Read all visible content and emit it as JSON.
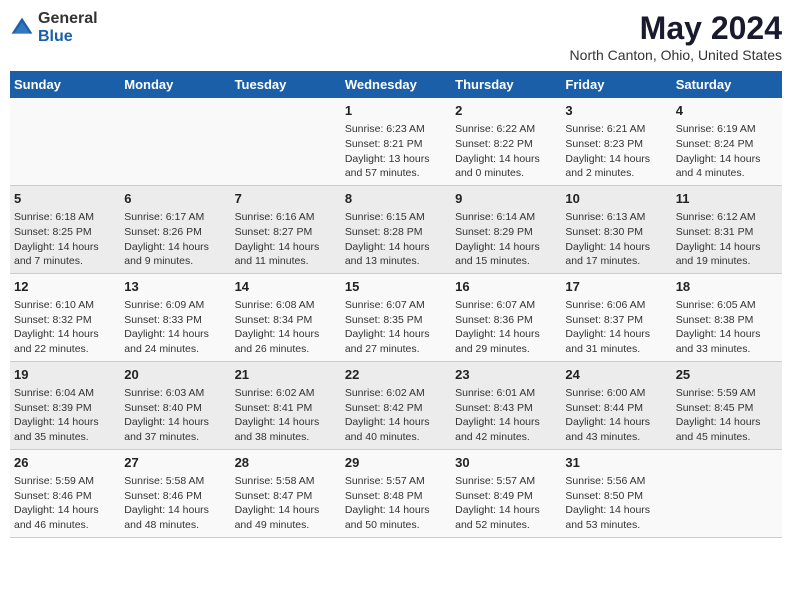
{
  "header": {
    "logo_general": "General",
    "logo_blue": "Blue",
    "title": "May 2024",
    "subtitle": "North Canton, Ohio, United States"
  },
  "columns": [
    "Sunday",
    "Monday",
    "Tuesday",
    "Wednesday",
    "Thursday",
    "Friday",
    "Saturday"
  ],
  "weeks": [
    [
      {
        "day": "",
        "info": ""
      },
      {
        "day": "",
        "info": ""
      },
      {
        "day": "",
        "info": ""
      },
      {
        "day": "1",
        "info": "Sunrise: 6:23 AM\nSunset: 8:21 PM\nDaylight: 13 hours and 57 minutes."
      },
      {
        "day": "2",
        "info": "Sunrise: 6:22 AM\nSunset: 8:22 PM\nDaylight: 14 hours and 0 minutes."
      },
      {
        "day": "3",
        "info": "Sunrise: 6:21 AM\nSunset: 8:23 PM\nDaylight: 14 hours and 2 minutes."
      },
      {
        "day": "4",
        "info": "Sunrise: 6:19 AM\nSunset: 8:24 PM\nDaylight: 14 hours and 4 minutes."
      }
    ],
    [
      {
        "day": "5",
        "info": "Sunrise: 6:18 AM\nSunset: 8:25 PM\nDaylight: 14 hours and 7 minutes."
      },
      {
        "day": "6",
        "info": "Sunrise: 6:17 AM\nSunset: 8:26 PM\nDaylight: 14 hours and 9 minutes."
      },
      {
        "day": "7",
        "info": "Sunrise: 6:16 AM\nSunset: 8:27 PM\nDaylight: 14 hours and 11 minutes."
      },
      {
        "day": "8",
        "info": "Sunrise: 6:15 AM\nSunset: 8:28 PM\nDaylight: 14 hours and 13 minutes."
      },
      {
        "day": "9",
        "info": "Sunrise: 6:14 AM\nSunset: 8:29 PM\nDaylight: 14 hours and 15 minutes."
      },
      {
        "day": "10",
        "info": "Sunrise: 6:13 AM\nSunset: 8:30 PM\nDaylight: 14 hours and 17 minutes."
      },
      {
        "day": "11",
        "info": "Sunrise: 6:12 AM\nSunset: 8:31 PM\nDaylight: 14 hours and 19 minutes."
      }
    ],
    [
      {
        "day": "12",
        "info": "Sunrise: 6:10 AM\nSunset: 8:32 PM\nDaylight: 14 hours and 22 minutes."
      },
      {
        "day": "13",
        "info": "Sunrise: 6:09 AM\nSunset: 8:33 PM\nDaylight: 14 hours and 24 minutes."
      },
      {
        "day": "14",
        "info": "Sunrise: 6:08 AM\nSunset: 8:34 PM\nDaylight: 14 hours and 26 minutes."
      },
      {
        "day": "15",
        "info": "Sunrise: 6:07 AM\nSunset: 8:35 PM\nDaylight: 14 hours and 27 minutes."
      },
      {
        "day": "16",
        "info": "Sunrise: 6:07 AM\nSunset: 8:36 PM\nDaylight: 14 hours and 29 minutes."
      },
      {
        "day": "17",
        "info": "Sunrise: 6:06 AM\nSunset: 8:37 PM\nDaylight: 14 hours and 31 minutes."
      },
      {
        "day": "18",
        "info": "Sunrise: 6:05 AM\nSunset: 8:38 PM\nDaylight: 14 hours and 33 minutes."
      }
    ],
    [
      {
        "day": "19",
        "info": "Sunrise: 6:04 AM\nSunset: 8:39 PM\nDaylight: 14 hours and 35 minutes."
      },
      {
        "day": "20",
        "info": "Sunrise: 6:03 AM\nSunset: 8:40 PM\nDaylight: 14 hours and 37 minutes."
      },
      {
        "day": "21",
        "info": "Sunrise: 6:02 AM\nSunset: 8:41 PM\nDaylight: 14 hours and 38 minutes."
      },
      {
        "day": "22",
        "info": "Sunrise: 6:02 AM\nSunset: 8:42 PM\nDaylight: 14 hours and 40 minutes."
      },
      {
        "day": "23",
        "info": "Sunrise: 6:01 AM\nSunset: 8:43 PM\nDaylight: 14 hours and 42 minutes."
      },
      {
        "day": "24",
        "info": "Sunrise: 6:00 AM\nSunset: 8:44 PM\nDaylight: 14 hours and 43 minutes."
      },
      {
        "day": "25",
        "info": "Sunrise: 5:59 AM\nSunset: 8:45 PM\nDaylight: 14 hours and 45 minutes."
      }
    ],
    [
      {
        "day": "26",
        "info": "Sunrise: 5:59 AM\nSunset: 8:46 PM\nDaylight: 14 hours and 46 minutes."
      },
      {
        "day": "27",
        "info": "Sunrise: 5:58 AM\nSunset: 8:46 PM\nDaylight: 14 hours and 48 minutes."
      },
      {
        "day": "28",
        "info": "Sunrise: 5:58 AM\nSunset: 8:47 PM\nDaylight: 14 hours and 49 minutes."
      },
      {
        "day": "29",
        "info": "Sunrise: 5:57 AM\nSunset: 8:48 PM\nDaylight: 14 hours and 50 minutes."
      },
      {
        "day": "30",
        "info": "Sunrise: 5:57 AM\nSunset: 8:49 PM\nDaylight: 14 hours and 52 minutes."
      },
      {
        "day": "31",
        "info": "Sunrise: 5:56 AM\nSunset: 8:50 PM\nDaylight: 14 hours and 53 minutes."
      },
      {
        "day": "",
        "info": ""
      }
    ]
  ]
}
